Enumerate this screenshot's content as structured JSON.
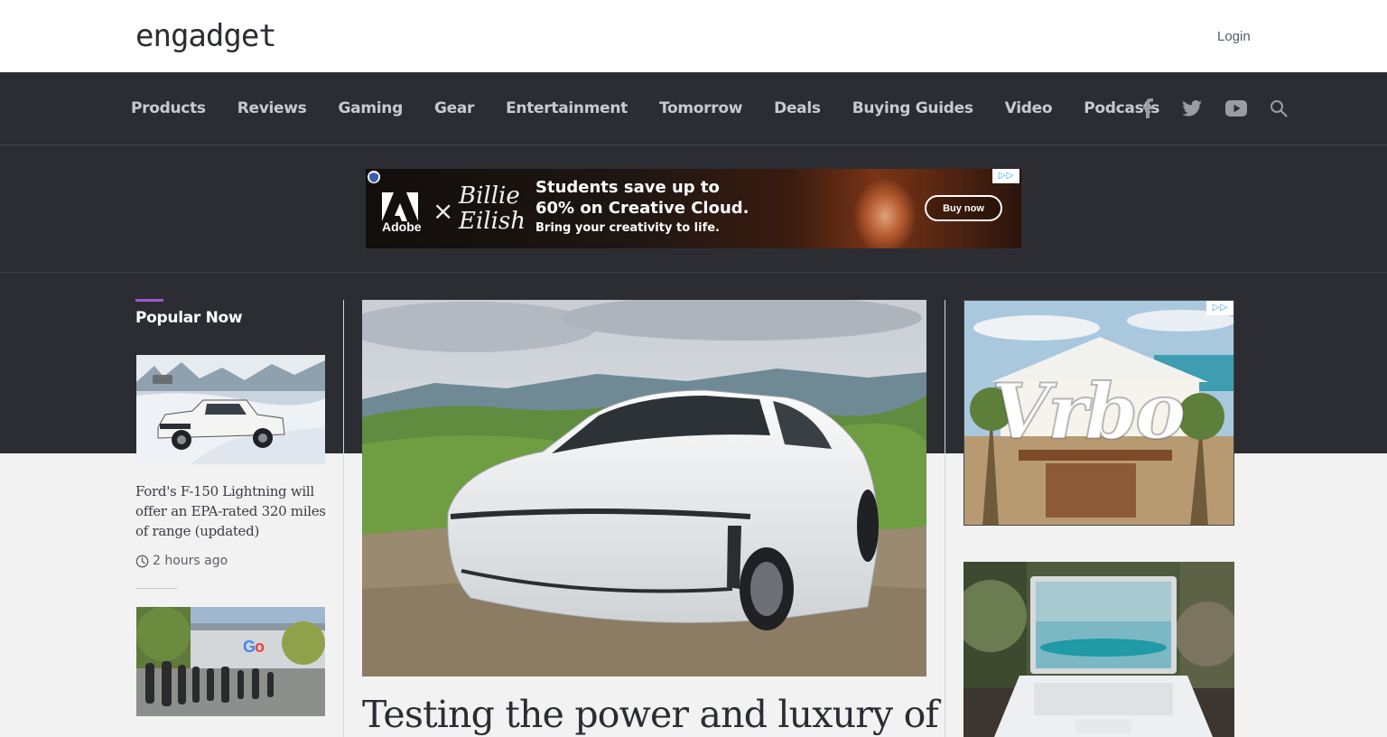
{
  "header": {
    "logo": "engadget",
    "login_label": "Login"
  },
  "nav": {
    "items": [
      "Products",
      "Reviews",
      "Gaming",
      "Gear",
      "Entertainment",
      "Tomorrow",
      "Deals",
      "Buying Guides",
      "Video",
      "Podcasts"
    ],
    "social_icons": [
      "facebook-icon",
      "twitter-icon",
      "youtube-icon",
      "search-icon"
    ]
  },
  "top_ad": {
    "brand": "Adobe",
    "partner": "Billie Eilish",
    "headline_line1": "Students save up to",
    "headline_line2": "60% on Creative Cloud.",
    "subline": "Bring your creativity to life.",
    "cta": "Buy now"
  },
  "popular_now": {
    "title": "Popular Now",
    "articles": [
      {
        "title": "Ford's F-150 Lightning will offer an EPA-rated 320 miles of range (updated)",
        "time": "2 hours ago"
      }
    ]
  },
  "hero": {
    "title": "Testing the power and luxury of"
  },
  "side_ad": {
    "brand": "Vrbo"
  },
  "colors": {
    "header_bg": "#ffffff",
    "nav_bg": "#2b2d32",
    "nav_text": "#c8cad0",
    "accent": "#9b59d0",
    "page_bg": "#f2f2f2"
  }
}
